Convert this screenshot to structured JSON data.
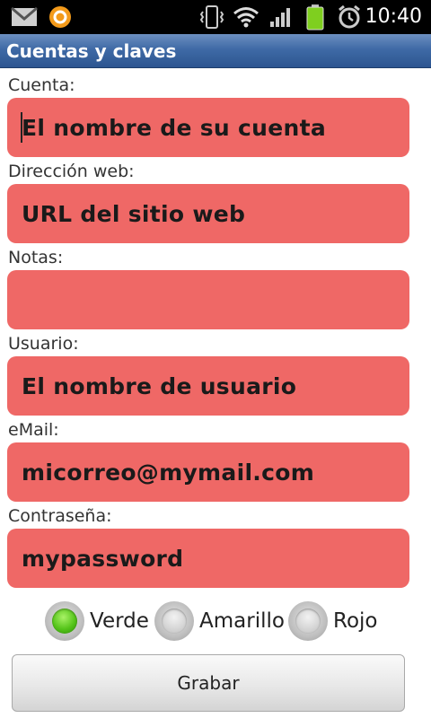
{
  "status_bar": {
    "time": "10:40",
    "icons": [
      "gmail-icon",
      "orange-app-icon",
      "vibrate-icon",
      "wifi-icon",
      "signal-icon",
      "battery-icon",
      "alarm-icon"
    ]
  },
  "app": {
    "title": "Cuentas y claves"
  },
  "form": {
    "fields": [
      {
        "label": "Cuenta:",
        "value": "El nombre de su cuenta"
      },
      {
        "label": "Dirección web:",
        "value": "URL del sitio web"
      },
      {
        "label": "Notas:",
        "value": ""
      },
      {
        "label": "Usuario:",
        "value": "El nombre de usuario"
      },
      {
        "label": "eMail:",
        "value": "micorreo@mymail.com"
      },
      {
        "label": "Contraseña:",
        "value": "mypassword"
      }
    ],
    "field_color": "#ef6866"
  },
  "priority": {
    "options": [
      {
        "label": "Verde",
        "checked": true
      },
      {
        "label": "Amarillo",
        "checked": false
      },
      {
        "label": "Rojo",
        "checked": false
      }
    ]
  },
  "save_button": {
    "label": "Grabar"
  }
}
